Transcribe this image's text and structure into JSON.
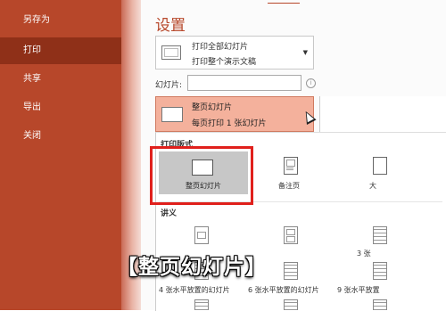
{
  "sidebar": {
    "items": [
      {
        "label": "另存为"
      },
      {
        "label": "打印",
        "active": true
      },
      {
        "label": "共享"
      },
      {
        "label": "导出"
      },
      {
        "label": "关闭"
      }
    ]
  },
  "settings": {
    "title": "设置",
    "print_range": {
      "line1": "打印全部幻灯片",
      "line2": "打印整个演示文稿"
    },
    "slides_label": "幻灯片:",
    "slides_value": "",
    "info_icon": "i",
    "layout": {
      "line1": "整页幻灯片",
      "line2": "每页打印 1 张幻灯片"
    }
  },
  "popup": {
    "print_layout_header": "打印版式",
    "layouts": [
      {
        "label": "整页幻灯片",
        "selected": true
      },
      {
        "label": "备注页"
      },
      {
        "label": "大"
      }
    ],
    "handouts_header": "讲义",
    "handouts_row2": [
      "3 张",
      "4 张水平放置的幻灯片",
      "6 张水平放置的幻灯片",
      "9 张水平放置"
    ]
  },
  "subtitle": "【整页幻灯片】",
  "colors": {
    "accent": "#b7472a",
    "highlight": "#f4b19c",
    "selection_frame": "#e0201c"
  }
}
